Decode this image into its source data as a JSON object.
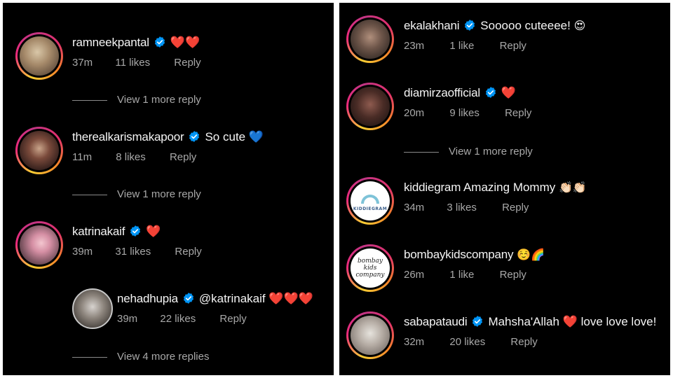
{
  "left_panel": {
    "comments": [
      {
        "username": "ramneekpantal",
        "text": "",
        "emoji": "❤️❤️",
        "time": "37m",
        "likes": "11 likes",
        "reply": "Reply"
      },
      {
        "username": "therealkarismakapoor",
        "text": "So cute",
        "emoji": "💙",
        "time": "11m",
        "likes": "8 likes",
        "reply": "Reply"
      },
      {
        "username": "katrinakaif",
        "text": "",
        "emoji": "❤️",
        "time": "39m",
        "likes": "31 likes",
        "reply": "Reply"
      },
      {
        "username": "nehadhupia",
        "text": "@katrinakaif",
        "emoji": "❤️❤️❤️",
        "time": "39m",
        "likes": "22 likes",
        "reply": "Reply"
      }
    ],
    "view_more": [
      "View 1 more reply",
      "View 1 more reply",
      "View 4 more replies"
    ]
  },
  "right_panel": {
    "comments": [
      {
        "username": "ekalakhani",
        "text": "Sooooo cuteeee!",
        "emoji": "😍",
        "time": "23m",
        "likes": "1 like",
        "reply": "Reply"
      },
      {
        "username": "diamirzaofficial",
        "text": "",
        "emoji": "❤️",
        "time": "20m",
        "likes": "9 likes",
        "reply": "Reply"
      },
      {
        "username": "kiddiegram",
        "text": "Amazing Mommy",
        "emoji": "👏🏻👏🏻",
        "time": "34m",
        "likes": "3 likes",
        "reply": "Reply",
        "logo_text": "KIDDIEGRAM"
      },
      {
        "username": "bombaykidscompany",
        "text": "",
        "emoji": "☺️🌈",
        "time": "26m",
        "likes": "1 like",
        "reply": "Reply",
        "logo_text": "bombay kids company"
      },
      {
        "username": "sabapataudi",
        "text": "Mahsha'Allah",
        "emoji": "❤️",
        "text2": "love love love!",
        "time": "32m",
        "likes": "20 likes",
        "reply": "Reply"
      }
    ],
    "view_more": [
      "View 1 more reply"
    ]
  },
  "colors": {
    "background": "#000000",
    "text": "#f5f5f5",
    "secondary_text": "#a8a8a8",
    "verified": "#0095f6",
    "heart": "#ff3040"
  },
  "icons": [
    "verified-badge-icon",
    "avatar"
  ]
}
